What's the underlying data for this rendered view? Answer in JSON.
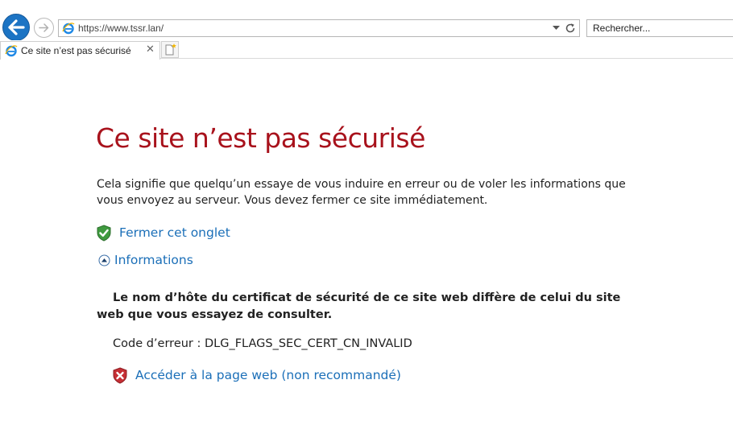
{
  "browser": {
    "address": "https://www.tssr.lan/",
    "search_placeholder": "Rechercher...",
    "tab_title": "Ce site n’est pas sécurisé",
    "tab_close": "✕"
  },
  "page": {
    "heading": "Ce site n’est pas sécurisé",
    "description": "Cela signifie que quelqu’un essaye de vous induire en erreur ou de voler les informations que vous envoyez au serveur. Vous devez fermer ce site immédiatement.",
    "close_tab_label": "Fermer cet onglet",
    "info_label": "Informations",
    "details_message": "Le nom d’hôte du certificat de sécurité de ce site web diffère de celui du site web que vous essayez de consulter.",
    "error_code": "Code d’erreur : DLG_FLAGS_SEC_CERT_CN_INVALID",
    "proceed_label": "Accéder à la page web (non recommandé)"
  },
  "colors": {
    "heading": "#a8121c",
    "link": "#1b6fb8",
    "back_button": "#1c74c4"
  },
  "icons": {
    "back": "back-arrow-icon",
    "forward": "forward-arrow-icon",
    "site": "ie-logo-icon",
    "refresh": "refresh-icon",
    "new_tab": "new-tab-icon",
    "close_tab_link": "green-shield-check-icon",
    "info_toggle": "collapse-arrow-icon",
    "proceed_link": "red-shield-x-icon"
  }
}
